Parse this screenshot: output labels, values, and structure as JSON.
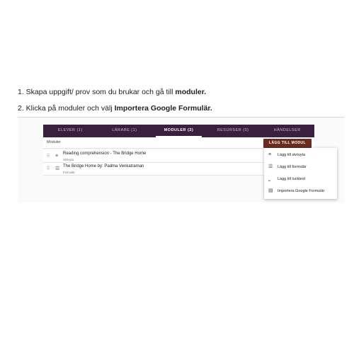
{
  "instructions": {
    "step1": {
      "prefix": "1. Skapa uppgift/ prov som du brukar och gå till ",
      "bold": "moduler."
    },
    "step2": {
      "prefix": "2. Klicka på moduler och välj ",
      "bold": "Importera Google Formulär."
    }
  },
  "tabs": [
    {
      "label": "ELEVER (1)",
      "active": false
    },
    {
      "label": "LÄRARE (1)",
      "active": false
    },
    {
      "label": "MODULER (2)",
      "active": true
    },
    {
      "label": "RESURSER (0)",
      "active": false
    },
    {
      "label": "HÄNDELSER",
      "active": false
    }
  ],
  "modules": {
    "label": "Moduler",
    "add_button": "LÄGG TILL MODUL",
    "rows": [
      {
        "title": "Reading comprehension - The Bridge Home",
        "subtitle": "Skrivyta"
      },
      {
        "title": "The Bridge Home by: Padma Venkatraman",
        "subtitle": "Formulär"
      }
    ]
  },
  "menu": {
    "items": [
      {
        "label": "Lägg till skrivyta",
        "icon": "text-lines-icon"
      },
      {
        "label": "Lägg till formulär",
        "icon": "list-icon"
      },
      {
        "label": "Lägg till lucktext",
        "icon": "blank-line-icon"
      },
      {
        "label": "Importera Google Formulär",
        "icon": "document-icon"
      }
    ]
  },
  "colors": {
    "tab_bar": "#3b1f3e",
    "add_button": "#6a2a1f"
  }
}
